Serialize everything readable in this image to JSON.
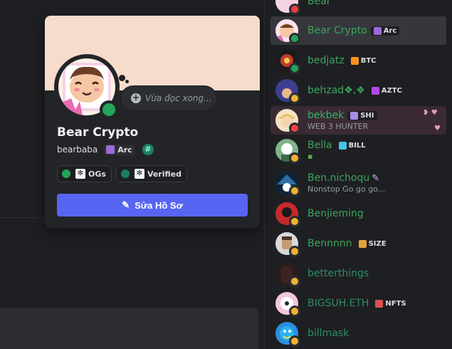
{
  "profile": {
    "display_name": "Bear Crypto",
    "username": "bearbaba",
    "server_tag": "Arc",
    "status_placeholder": "Vừa đọc xong...",
    "roles": [
      {
        "label": "OGs",
        "color": "#23a55a"
      },
      {
        "label": "Verified",
        "color": "#1a7f64"
      }
    ],
    "edit_button": "Sửa Hồ Sơ",
    "colors": {
      "banner": "#f7dccb",
      "button": "#5865f2"
    }
  },
  "members": [
    {
      "name": "Bear",
      "tag": "",
      "status_text": "",
      "presence": "dnd"
    },
    {
      "name": "Bear Crypto",
      "tag": "Arc",
      "status_text": "",
      "presence": "online"
    },
    {
      "name": "bedjatz",
      "tag": "BTC",
      "status_text": "",
      "presence": "online"
    },
    {
      "name": "behzad❖,❖",
      "tag": "AZTC",
      "status_text": "",
      "presence": "idle"
    },
    {
      "name": "bekbek",
      "tag": "SHI",
      "status_text": "WEB 3 HUNTER",
      "presence": "dnd"
    },
    {
      "name": "Bella",
      "tag": "BILL",
      "status_text": "",
      "presence": "idle"
    },
    {
      "name": "Ben.nichoqu",
      "tag": "",
      "status_text": "Nonstop Go go go...",
      "presence": "idle"
    },
    {
      "name": "Benjieming",
      "tag": "",
      "status_text": "",
      "presence": "idle"
    },
    {
      "name": "Bennnnn",
      "tag": "SIZE",
      "status_text": "",
      "presence": "idle"
    },
    {
      "name": "betterthings",
      "tag": "",
      "status_text": "",
      "presence": "idle"
    },
    {
      "name": "BIGSUH.ETH",
      "tag": "NFTS",
      "status_text": "",
      "presence": "idle"
    },
    {
      "name": "billmask",
      "tag": "",
      "status_text": "",
      "presence": "idle"
    }
  ]
}
